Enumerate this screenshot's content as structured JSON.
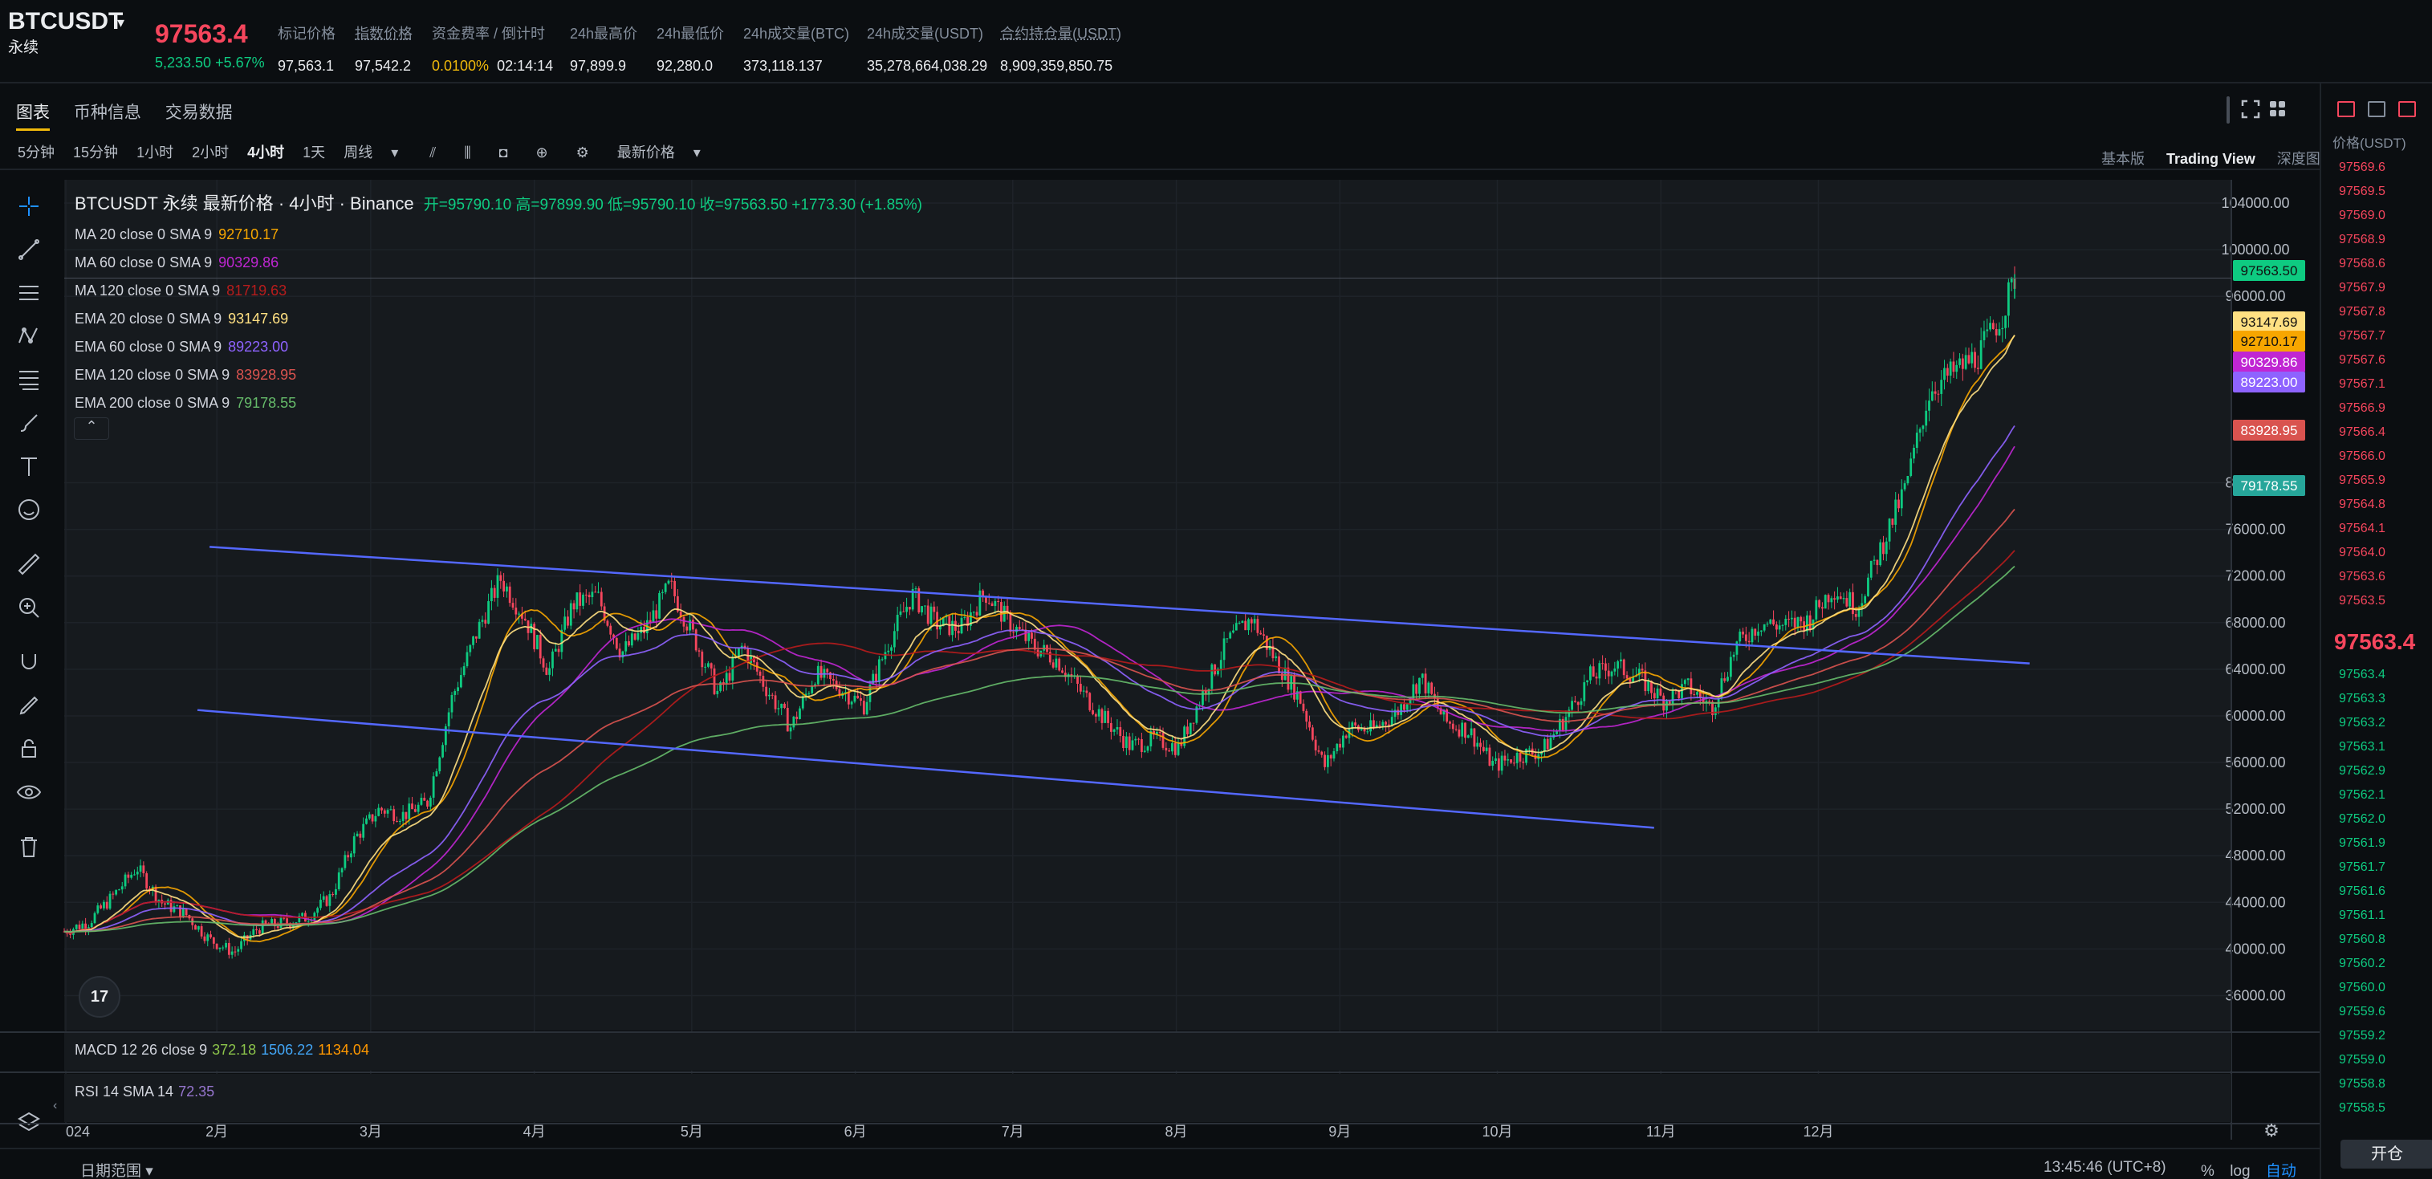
{
  "ticker": {
    "symbol": "BTCUSDT",
    "sub": "永续",
    "last_price": "97563.4",
    "change": "5,233.50 +5.67%",
    "stats": [
      {
        "label": "标记价格",
        "value": "97,563.1",
        "underline": false
      },
      {
        "label": "指数价格",
        "value": "97,542.2",
        "underline": true
      },
      {
        "label": "资金费率 / 倒计时",
        "value": "0.0100%",
        "value2": "02:14:14",
        "underline": false
      },
      {
        "label": "24h最高价",
        "value": "97,899.9",
        "underline": false
      },
      {
        "label": "24h最低价",
        "value": "92,280.0",
        "underline": false
      },
      {
        "label": "24h成交量(BTC)",
        "value": "373,118.137",
        "underline": false
      },
      {
        "label": "24h成交量(USDT)",
        "value": "35,278,664,038.29",
        "underline": false
      },
      {
        "label": "合约持仓量(USDT)",
        "value": "8,909,359,850.75",
        "underline": true
      }
    ]
  },
  "tabs": [
    "图表",
    "币种信息",
    "交易数据"
  ],
  "intervals": [
    "5分钟",
    "15分钟",
    "1小时",
    "2小时",
    "4小时",
    "1天",
    "周线"
  ],
  "active_interval": "4小时",
  "price_type": "最新价格",
  "views": [
    "基本版",
    "Trading View",
    "深度图"
  ],
  "legend": {
    "title": "BTCUSDT 永续 最新价格 · 4小时 · Binance",
    "ohlc": "开=95790.10 高=97899.90 低=95790.10 收=97563.50 +1773.30 (+1.85%)",
    "indicators": [
      {
        "name": "MA 20 close 0 SMA 9",
        "value": "92710.17",
        "color": "#f7a600"
      },
      {
        "name": "MA 60 close 0 SMA 9",
        "value": "90329.86",
        "color": "#c026d3"
      },
      {
        "name": "MA 120 close 0 SMA 9",
        "value": "81719.63",
        "color": "#b71c1c"
      },
      {
        "name": "EMA 20 close 0 SMA 9",
        "value": "93147.69",
        "color": "#ffe082"
      },
      {
        "name": "EMA 60 close 0 SMA 9",
        "value": "89223.00",
        "color": "#8e63ff"
      },
      {
        "name": "EMA 120 close 0 SMA 9",
        "value": "83928.95",
        "color": "#d9534f"
      },
      {
        "name": "EMA 200 close 0 SMA 9",
        "value": "79178.55",
        "color": "#66bb6a"
      }
    ]
  },
  "macd": {
    "label": "MACD 12 26 close 9",
    "values": [
      "372.18",
      "1506.22",
      "1134.04"
    ],
    "colors": [
      "#8bc34a",
      "#42a5f5",
      "#ff9800"
    ]
  },
  "rsi": {
    "label": "RSI 14 SMA 14",
    "value": "72.35",
    "color": "#9575cd"
  },
  "chart_data": {
    "type": "candlestick",
    "y_ticks": [
      "104000.00",
      "100000.00",
      "96000.00",
      "80000.00",
      "76000.00",
      "72000.00",
      "68000.00",
      "64000.00",
      "60000.00",
      "56000.00",
      "52000.00",
      "48000.00",
      "44000.00",
      "40000.00",
      "36000.00"
    ],
    "ylim": [
      33000,
      106000
    ],
    "x_labels": [
      "024",
      "2月",
      "3月",
      "4月",
      "5月",
      "6月",
      "7月",
      "8月",
      "9月",
      "10月",
      "11月",
      "12月"
    ],
    "price_series": [
      [
        0,
        41500
      ],
      [
        2,
        42300
      ],
      [
        4,
        44500
      ],
      [
        6,
        47000
      ],
      [
        8,
        44000
      ],
      [
        10,
        43000
      ],
      [
        12,
        40800
      ],
      [
        14,
        39700
      ],
      [
        16,
        41800
      ],
      [
        18,
        42200
      ],
      [
        20,
        42700
      ],
      [
        22,
        44500
      ],
      [
        24,
        49500
      ],
      [
        26,
        52000
      ],
      [
        28,
        51500
      ],
      [
        30,
        52600
      ],
      [
        32,
        61500
      ],
      [
        34,
        67000
      ],
      [
        36,
        71800
      ],
      [
        38,
        68500
      ],
      [
        40,
        63800
      ],
      [
        42,
        69600
      ],
      [
        44,
        70300
      ],
      [
        46,
        65400
      ],
      [
        48,
        67500
      ],
      [
        50,
        71200
      ],
      [
        52,
        66700
      ],
      [
        54,
        61800
      ],
      [
        56,
        66000
      ],
      [
        58,
        62300
      ],
      [
        60,
        59000
      ],
      [
        62,
        63600
      ],
      [
        64,
        62400
      ],
      [
        66,
        60900
      ],
      [
        68,
        66200
      ],
      [
        70,
        70400
      ],
      [
        72,
        67900
      ],
      [
        74,
        67500
      ],
      [
        76,
        70600
      ],
      [
        78,
        68000
      ],
      [
        80,
        66000
      ],
      [
        82,
        64800
      ],
      [
        84,
        62000
      ],
      [
        86,
        59600
      ],
      [
        88,
        57400
      ],
      [
        90,
        58000
      ],
      [
        92,
        57300
      ],
      [
        94,
        62000
      ],
      [
        96,
        66300
      ],
      [
        98,
        68400
      ],
      [
        100,
        64800
      ],
      [
        102,
        61500
      ],
      [
        104,
        55600
      ],
      [
        106,
        59000
      ],
      [
        108,
        58800
      ],
      [
        110,
        60300
      ],
      [
        112,
        63300
      ],
      [
        114,
        59500
      ],
      [
        116,
        58700
      ],
      [
        118,
        55700
      ],
      [
        120,
        56600
      ],
      [
        122,
        57000
      ],
      [
        124,
        60000
      ],
      [
        126,
        63400
      ],
      [
        128,
        64300
      ],
      [
        130,
        63300
      ],
      [
        132,
        61300
      ],
      [
        134,
        62500
      ],
      [
        136,
        60700
      ],
      [
        138,
        66000
      ],
      [
        140,
        68000
      ],
      [
        142,
        67700
      ],
      [
        144,
        68200
      ],
      [
        146,
        71000
      ],
      [
        148,
        69300
      ],
      [
        150,
        74500
      ],
      [
        152,
        79600
      ],
      [
        154,
        88000
      ],
      [
        156,
        89500
      ],
      [
        158,
        91000
      ],
      [
        160,
        94500
      ],
      [
        161,
        97563
      ]
    ],
    "channel_lines": [
      {
        "from": [
          12,
          74500
        ],
        "to": [
          147,
          64500
        ],
        "color": "#5468ff"
      },
      {
        "from": [
          11,
          60500
        ],
        "to": [
          116,
          50400
        ],
        "color": "#5468ff"
      }
    ],
    "price_tags": [
      {
        "value": "97563.50",
        "price": 97563,
        "color": "#0ecb81"
      },
      {
        "value": "93147.69",
        "price": 93147,
        "color": "#ffe082"
      },
      {
        "value": "92710.17",
        "price": 92710,
        "color": "#f7a600"
      },
      {
        "value": "90329.86",
        "price": 90330,
        "color": "#c026d3"
      },
      {
        "value": "89223.00",
        "price": 89223,
        "color": "#8e63ff"
      },
      {
        "value": "83928.95",
        "price": 83929,
        "color": "#d9534f"
      },
      {
        "value": "79178.55",
        "price": 79178,
        "color": "#26a69a"
      }
    ]
  },
  "order_book": {
    "header": "价格(USDT)",
    "asks": [
      "97569.6",
      "97569.5",
      "97569.0",
      "97568.9",
      "97568.6",
      "97567.9",
      "97567.8",
      "97567.7",
      "97567.6",
      "97567.1",
      "97566.9",
      "97566.4",
      "97566.0",
      "97565.9",
      "97564.8",
      "97564.1",
      "97564.0",
      "97563.6",
      "97563.5"
    ],
    "mid": "97563.4",
    "bids": [
      "97563.4",
      "97563.3",
      "97563.2",
      "97563.1",
      "97562.9",
      "97562.1",
      "97562.0",
      "97561.9",
      "97561.7",
      "97561.6",
      "97561.1",
      "97560.8",
      "97560.2",
      "97560.0",
      "97559.6",
      "97559.2",
      "97559.0",
      "97558.8",
      "97558.5"
    ],
    "close_button": "开仓"
  },
  "footer": {
    "date_range": "日期范围",
    "clock": "13:45:46 (UTC+8)",
    "scale_options": [
      "%",
      "log",
      "自动"
    ]
  },
  "colors": {
    "up": "#0ecb81",
    "down": "#f6465d",
    "accent": "#f0b90b"
  }
}
